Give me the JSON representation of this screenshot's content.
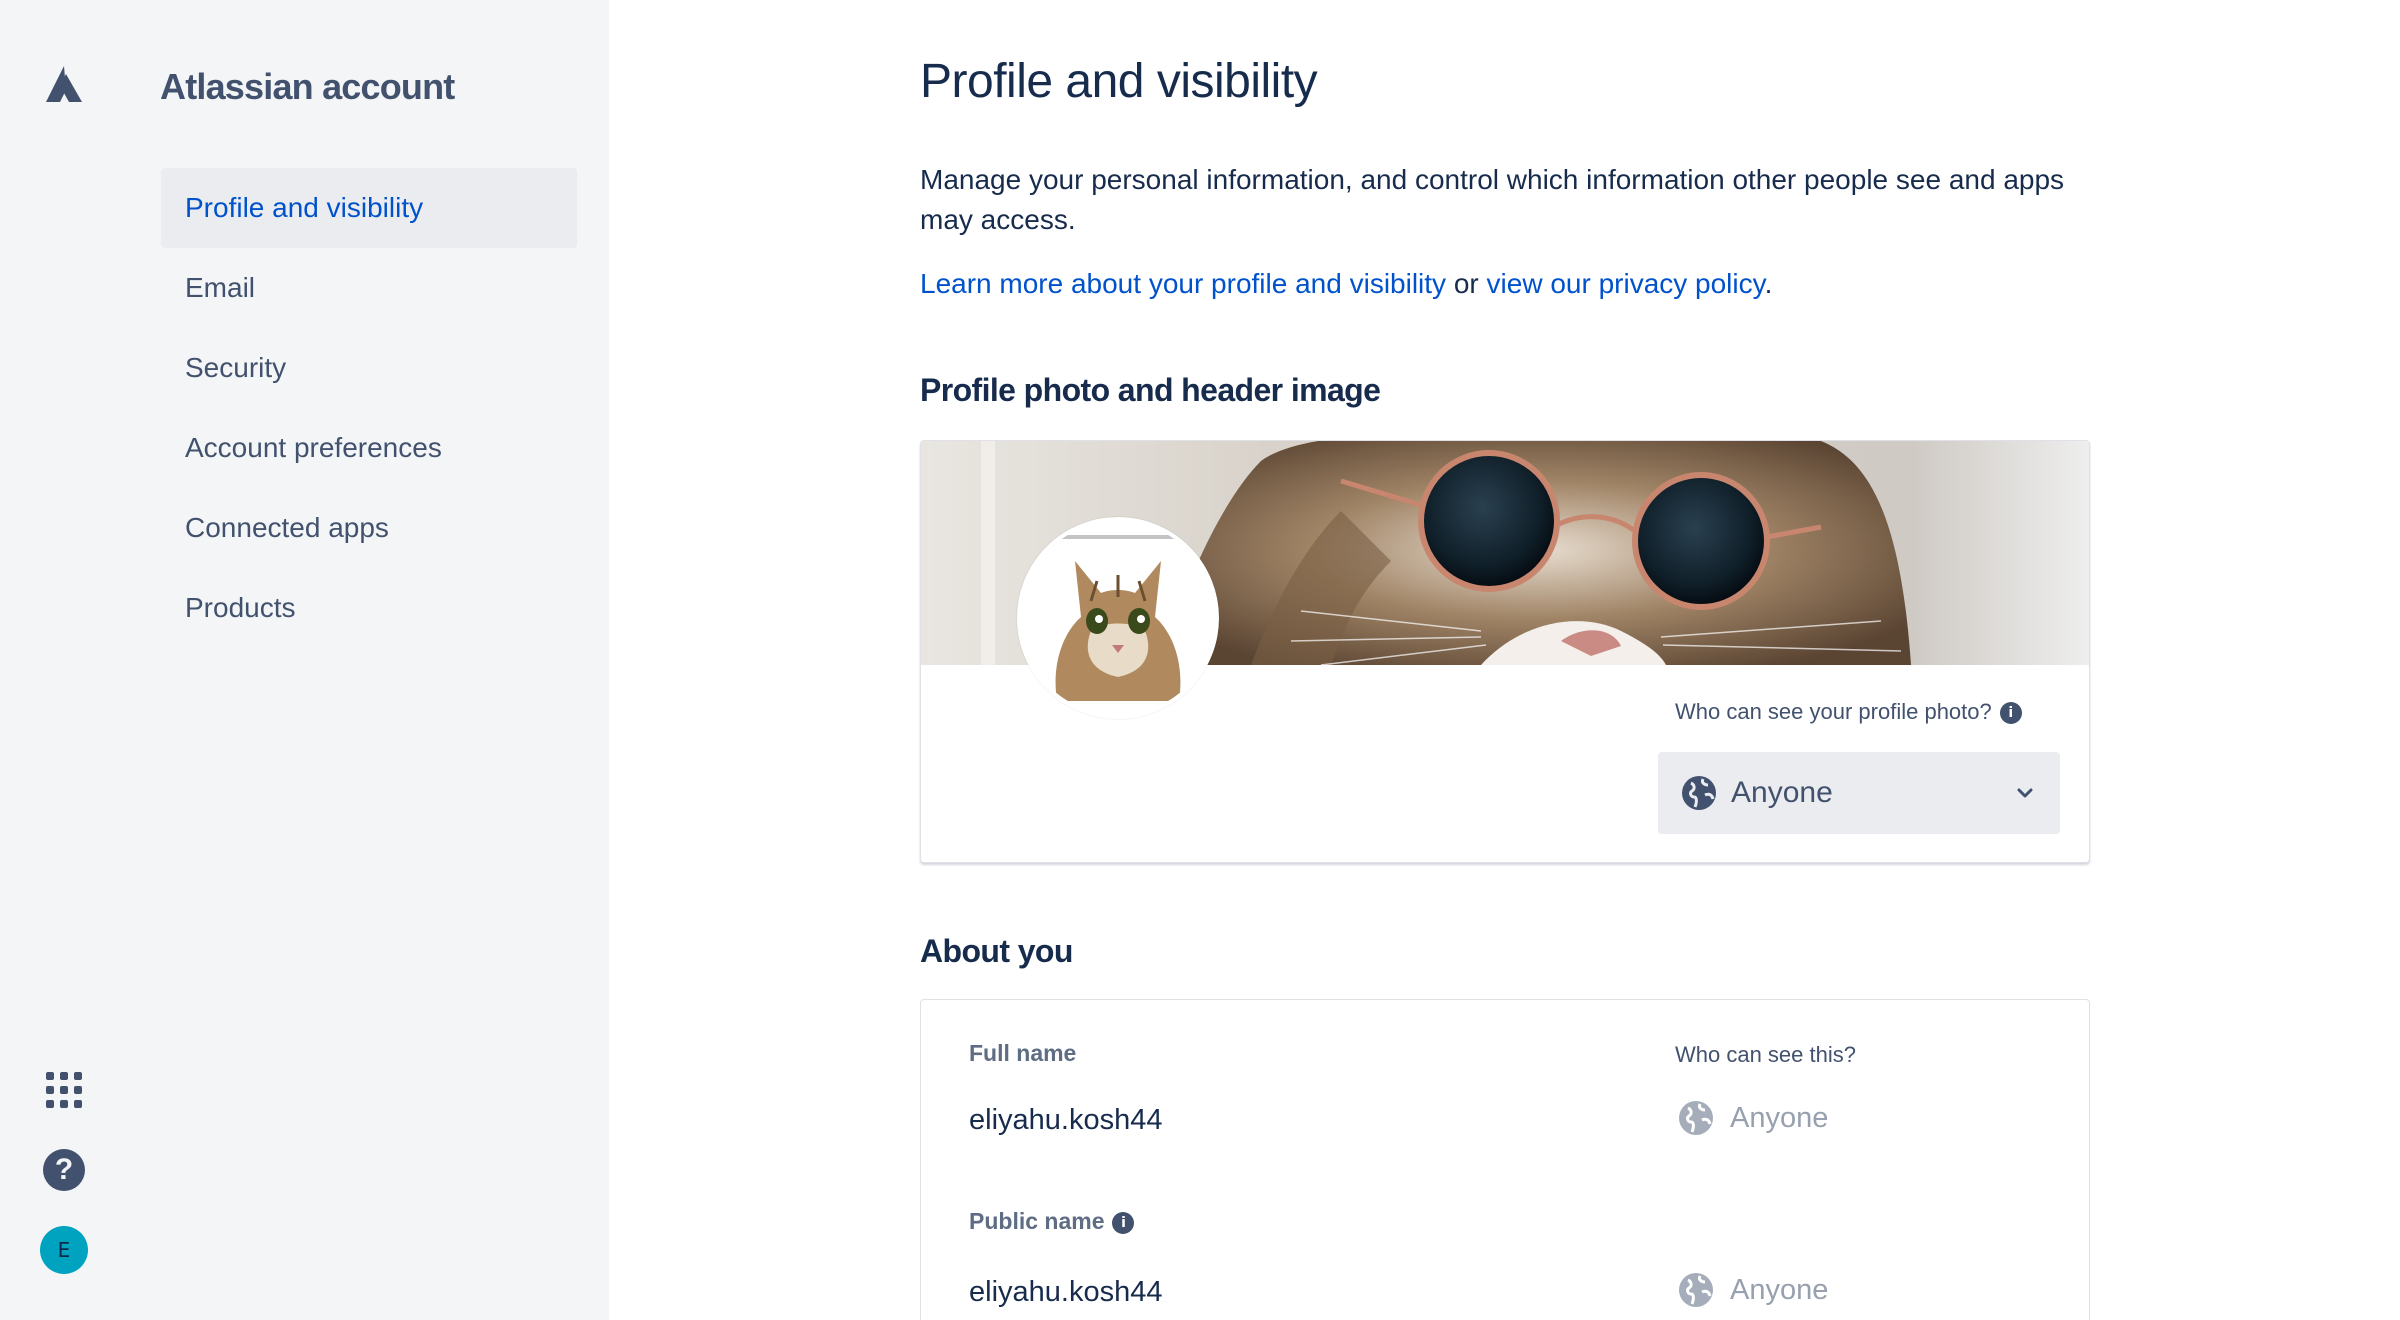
{
  "sidebar": {
    "title": "Atlassian account",
    "items": [
      {
        "label": "Profile and visibility",
        "active": true
      },
      {
        "label": "Email"
      },
      {
        "label": "Security"
      },
      {
        "label": "Account preferences"
      },
      {
        "label": "Connected apps"
      },
      {
        "label": "Products"
      }
    ],
    "bottom_icons": [
      "app-switcher-icon",
      "help-icon"
    ],
    "avatar_initial": "E"
  },
  "main": {
    "page_title": "Profile and visibility",
    "intro": "Manage your personal information, and control which information other people see and apps may access.",
    "link_profile": "Learn more about your profile and visibility",
    "link_or": " or ",
    "link_privacy": "view our privacy policy",
    "link_end": ".",
    "photo_section": {
      "title": "Profile photo and header image",
      "visibility_label": "Who can see your profile photo?",
      "visibility_value": "Anyone"
    },
    "about_section": {
      "title": "About you",
      "who_label": "Who can see this?",
      "fields": [
        {
          "label": "Full name",
          "value": "eliyahu.kosh44",
          "visibility": "Anyone"
        },
        {
          "label": "Public name",
          "value": "eliyahu.kosh44",
          "visibility": "Anyone"
        }
      ]
    }
  },
  "colors": {
    "accent": "#0052cc",
    "sidebar_bg": "#f4f5f7",
    "text": "#172b4d",
    "muted": "#42526e",
    "avatar": "#00a3bf"
  }
}
